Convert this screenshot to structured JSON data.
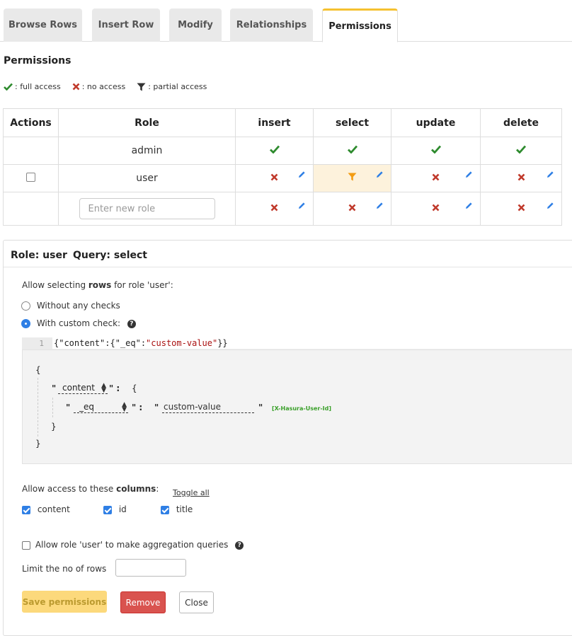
{
  "tabs": [
    {
      "label": "Browse Rows"
    },
    {
      "label": "Insert Row"
    },
    {
      "label": "Modify"
    },
    {
      "label": "Relationships"
    },
    {
      "label": "Permissions"
    }
  ],
  "heading": "Permissions",
  "legend": {
    "full": ": full access",
    "none": ": no access",
    "partial": ": partial access"
  },
  "table": {
    "headers": [
      "Actions",
      "Role",
      "insert",
      "select",
      "update",
      "delete"
    ],
    "rows": [
      {
        "role": "admin",
        "cells": [
          "full",
          "full",
          "full",
          "full"
        ]
      },
      {
        "role": "user",
        "cells": [
          "none",
          "partial",
          "none",
          "none"
        ]
      }
    ],
    "new_role_placeholder": "Enter new role"
  },
  "panel": {
    "role_label": "Role: user",
    "query_label": "Query: select",
    "allow_rows_prefix": "Allow selecting ",
    "allow_rows_bold": "rows",
    "allow_rows_suffix": " for role 'user':",
    "option_no_checks": "Without any checks",
    "option_custom": "With custom check:",
    "editor": {
      "line_number": "1",
      "code_prefix": "{\"content\":{\"_eq\":",
      "code_string": "\"custom-value\"",
      "code_suffix": "}}"
    },
    "builder": {
      "open_brace": "{",
      "close_brace": "}",
      "column": "content",
      "operator": "_eq",
      "value": "custom-value",
      "session_var": "[X-Hasura-User-Id]"
    },
    "columns_prefix": "Allow access to these ",
    "columns_bold": "columns",
    "columns_suffix": ":",
    "toggle_all": "Toggle all",
    "columns": [
      {
        "name": "content",
        "checked": true
      },
      {
        "name": "id",
        "checked": true
      },
      {
        "name": "title",
        "checked": true
      }
    ],
    "aggregation_label": "Allow role 'user' to make aggregation queries",
    "limit_label": "Limit the no of rows",
    "limit_value": "",
    "buttons": {
      "save": "Save permissions",
      "remove": "Remove",
      "close": "Close"
    }
  },
  "colors": {
    "full": "#2e8b2e",
    "none": "#c0392b",
    "partial": "#f39c12",
    "accent": "#f5c130",
    "edit": "#2f7fe5"
  }
}
